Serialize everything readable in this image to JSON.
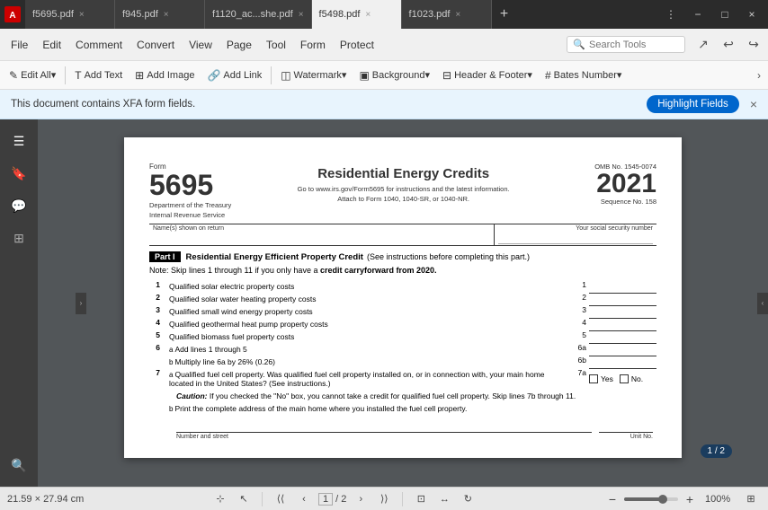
{
  "titlebar": {
    "tabs": [
      {
        "label": "f5695.pdf",
        "active": false
      },
      {
        "label": "f945.pdf",
        "active": false
      },
      {
        "label": "f1120_ac...she.pdf",
        "active": false
      },
      {
        "label": "f5498.pdf",
        "active": true
      },
      {
        "label": "f1023.pdf",
        "active": false
      }
    ],
    "add_tab": "+",
    "controls": [
      "−",
      "□",
      "×"
    ]
  },
  "menubar": {
    "items": [
      "File",
      "Edit",
      "Comment",
      "Convert",
      "View",
      "Page",
      "Tool",
      "Form",
      "Protect"
    ],
    "active_item": "Edit",
    "search_placeholder": "Search Tools"
  },
  "toolbar": {
    "buttons": [
      {
        "label": "Edit All",
        "icon": "✎"
      },
      {
        "label": "Add Text",
        "icon": "T"
      },
      {
        "label": "Add Image",
        "icon": "🖼"
      },
      {
        "label": "Add Link",
        "icon": "🔗"
      },
      {
        "label": "Watermark",
        "icon": "W"
      },
      {
        "label": "Background",
        "icon": "B"
      },
      {
        "label": "Header & Footer",
        "icon": "H"
      },
      {
        "label": "Bates Number",
        "icon": "#"
      }
    ]
  },
  "xfa_banner": {
    "message": "This document contains XFA form fields.",
    "highlight_btn": "Highlight Fields",
    "close": "×"
  },
  "left_panel": {
    "buttons": [
      {
        "icon": "☰",
        "label": "menu-toggle"
      },
      {
        "icon": "🔖",
        "label": "bookmark"
      },
      {
        "icon": "💬",
        "label": "comment"
      },
      {
        "icon": "⊞",
        "label": "thumbnails"
      },
      {
        "icon": "🔍",
        "label": "search"
      }
    ]
  },
  "pdf": {
    "form_label": "Form",
    "form_number": "5695",
    "dept_line1": "Department of the Treasury",
    "dept_line2": "Internal Revenue Service",
    "form_title": "Residential Energy Credits",
    "instructions_line1": "Go to www.irs.gov/Form5695 for instructions and the latest information.",
    "instructions_line2": "Attach to Form 1040, 1040-SR, or 1040-NR.",
    "omb": "OMB No. 1545-0074",
    "year": "2021",
    "seq_label": "Sequence No.",
    "seq_num": "158",
    "name_label": "Name(s) shown on return",
    "ssn_label": "Your social security number",
    "part1_label": "Part I",
    "part1_title": "Residential Energy Efficient Property Credit",
    "part1_instructions": "(See instructions before completing this part.)",
    "note_text": "Note: Skip lines 1 through 11 if you only have a",
    "note_bold": "credit carryforward from 2020.",
    "lines": [
      {
        "num": "1",
        "sub": "",
        "desc": "Qualified solar electric property costs",
        "right_num": "1"
      },
      {
        "num": "2",
        "sub": "",
        "desc": "Qualified solar water heating property costs",
        "right_num": "2"
      },
      {
        "num": "3",
        "sub": "",
        "desc": "Qualified small wind energy property costs",
        "right_num": "3"
      },
      {
        "num": "4",
        "sub": "",
        "desc": "Qualified geothermal heat pump property costs",
        "right_num": "4"
      },
      {
        "num": "5",
        "sub": "",
        "desc": "Qualified biomass fuel property costs",
        "right_num": "5"
      },
      {
        "num": "6",
        "sub": "a",
        "desc": "Add lines 1 through 5",
        "right_num": "6a"
      },
      {
        "num": "",
        "sub": "b",
        "desc": "Multiply line 6a by 26% (0.26)",
        "right_num": "6b"
      },
      {
        "num": "7",
        "sub": "a",
        "desc": "Qualified fuel cell property. Was qualified fuel cell property installed on, or in connection with, your main home located in the United States? (See instructions.)",
        "right_num": "7a",
        "yes_no": true
      },
      {
        "num": "",
        "sub": "",
        "desc": "Caution: If you checked the \"No\" box, you cannot take a credit for qualified fuel cell property. Skip lines 7b through 11.",
        "caution": true
      },
      {
        "num": "",
        "sub": "b",
        "desc": "Print the complete address of the main home where you installed the fuel cell property.",
        "address": true
      }
    ]
  },
  "statusbar": {
    "size": "21.59 × 27.94 cm",
    "page_current": "1",
    "page_total": "2",
    "page_indicator": "1 / 2",
    "zoom": "100%"
  }
}
